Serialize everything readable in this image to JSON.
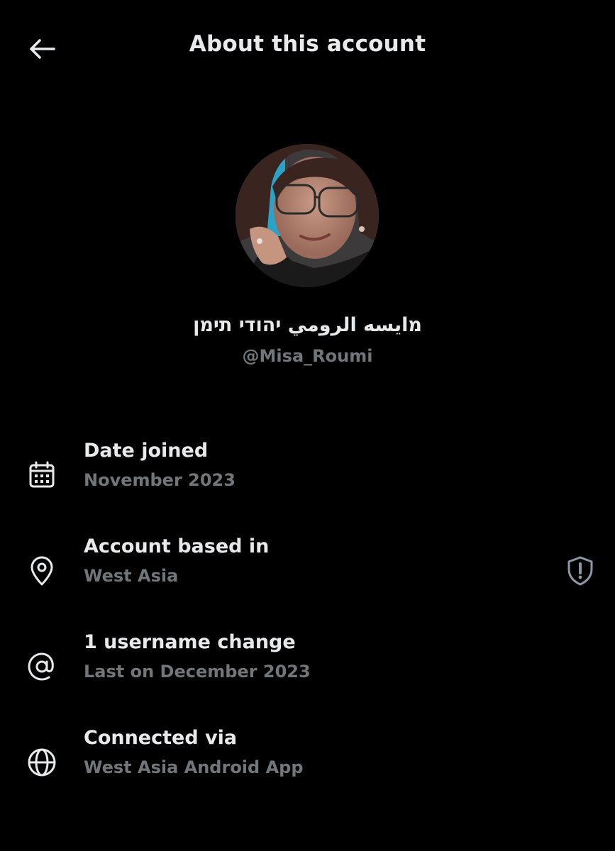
{
  "header": {
    "title": "About this account",
    "back_icon": "arrow-left-icon"
  },
  "profile": {
    "display_name": "מايسه الرومي יהודי תימן",
    "handle": "@Misa_Roumi",
    "avatar": "profile-photo"
  },
  "info_rows": [
    {
      "icon": "calendar-icon",
      "title": "Date joined",
      "subtitle": "November 2023"
    },
    {
      "icon": "location-pin-icon",
      "title": "Account based in",
      "subtitle": "West Asia",
      "action_icon": "shield-alert-icon"
    },
    {
      "icon": "at-sign-icon",
      "title": "1 username change",
      "subtitle": "Last on December 2023"
    },
    {
      "icon": "globe-icon",
      "title": "Connected via",
      "subtitle": "West Asia Android App"
    }
  ],
  "colors": {
    "background": "#000000",
    "primary_text": "#e7e9ea",
    "secondary_text": "#71767b"
  }
}
